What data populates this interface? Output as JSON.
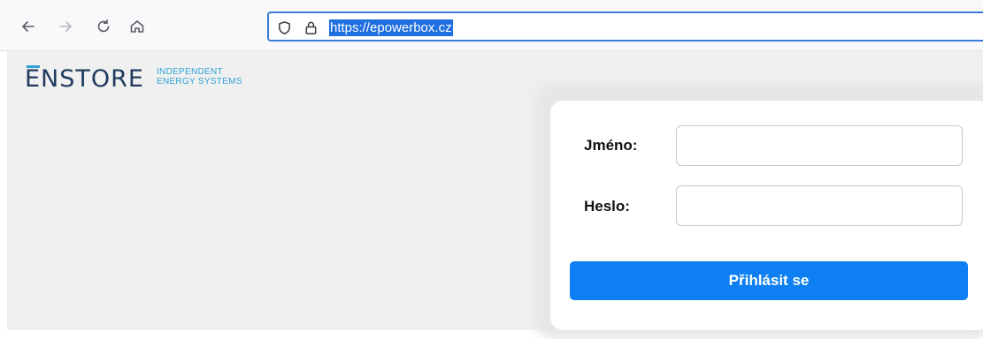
{
  "browser": {
    "url": "https://epowerbox.cz",
    "icons": [
      "back-arrow-icon",
      "forward-arrow-icon",
      "reload-icon",
      "home-icon",
      "shield-icon",
      "lock-icon"
    ]
  },
  "brand": {
    "name": "ENSTORE",
    "tagline_line1": "INDEPENDENT",
    "tagline_line2": "ENERGY SYSTEMS",
    "colors": {
      "wordmark": "#1f3a5c",
      "accent": "#2fa3d8"
    }
  },
  "login": {
    "username_label": "Jméno:",
    "username_value": "",
    "password_label": "Heslo:",
    "password_value": "",
    "submit_label": "Přihlásit se",
    "button_color": "#0d7ff2"
  }
}
